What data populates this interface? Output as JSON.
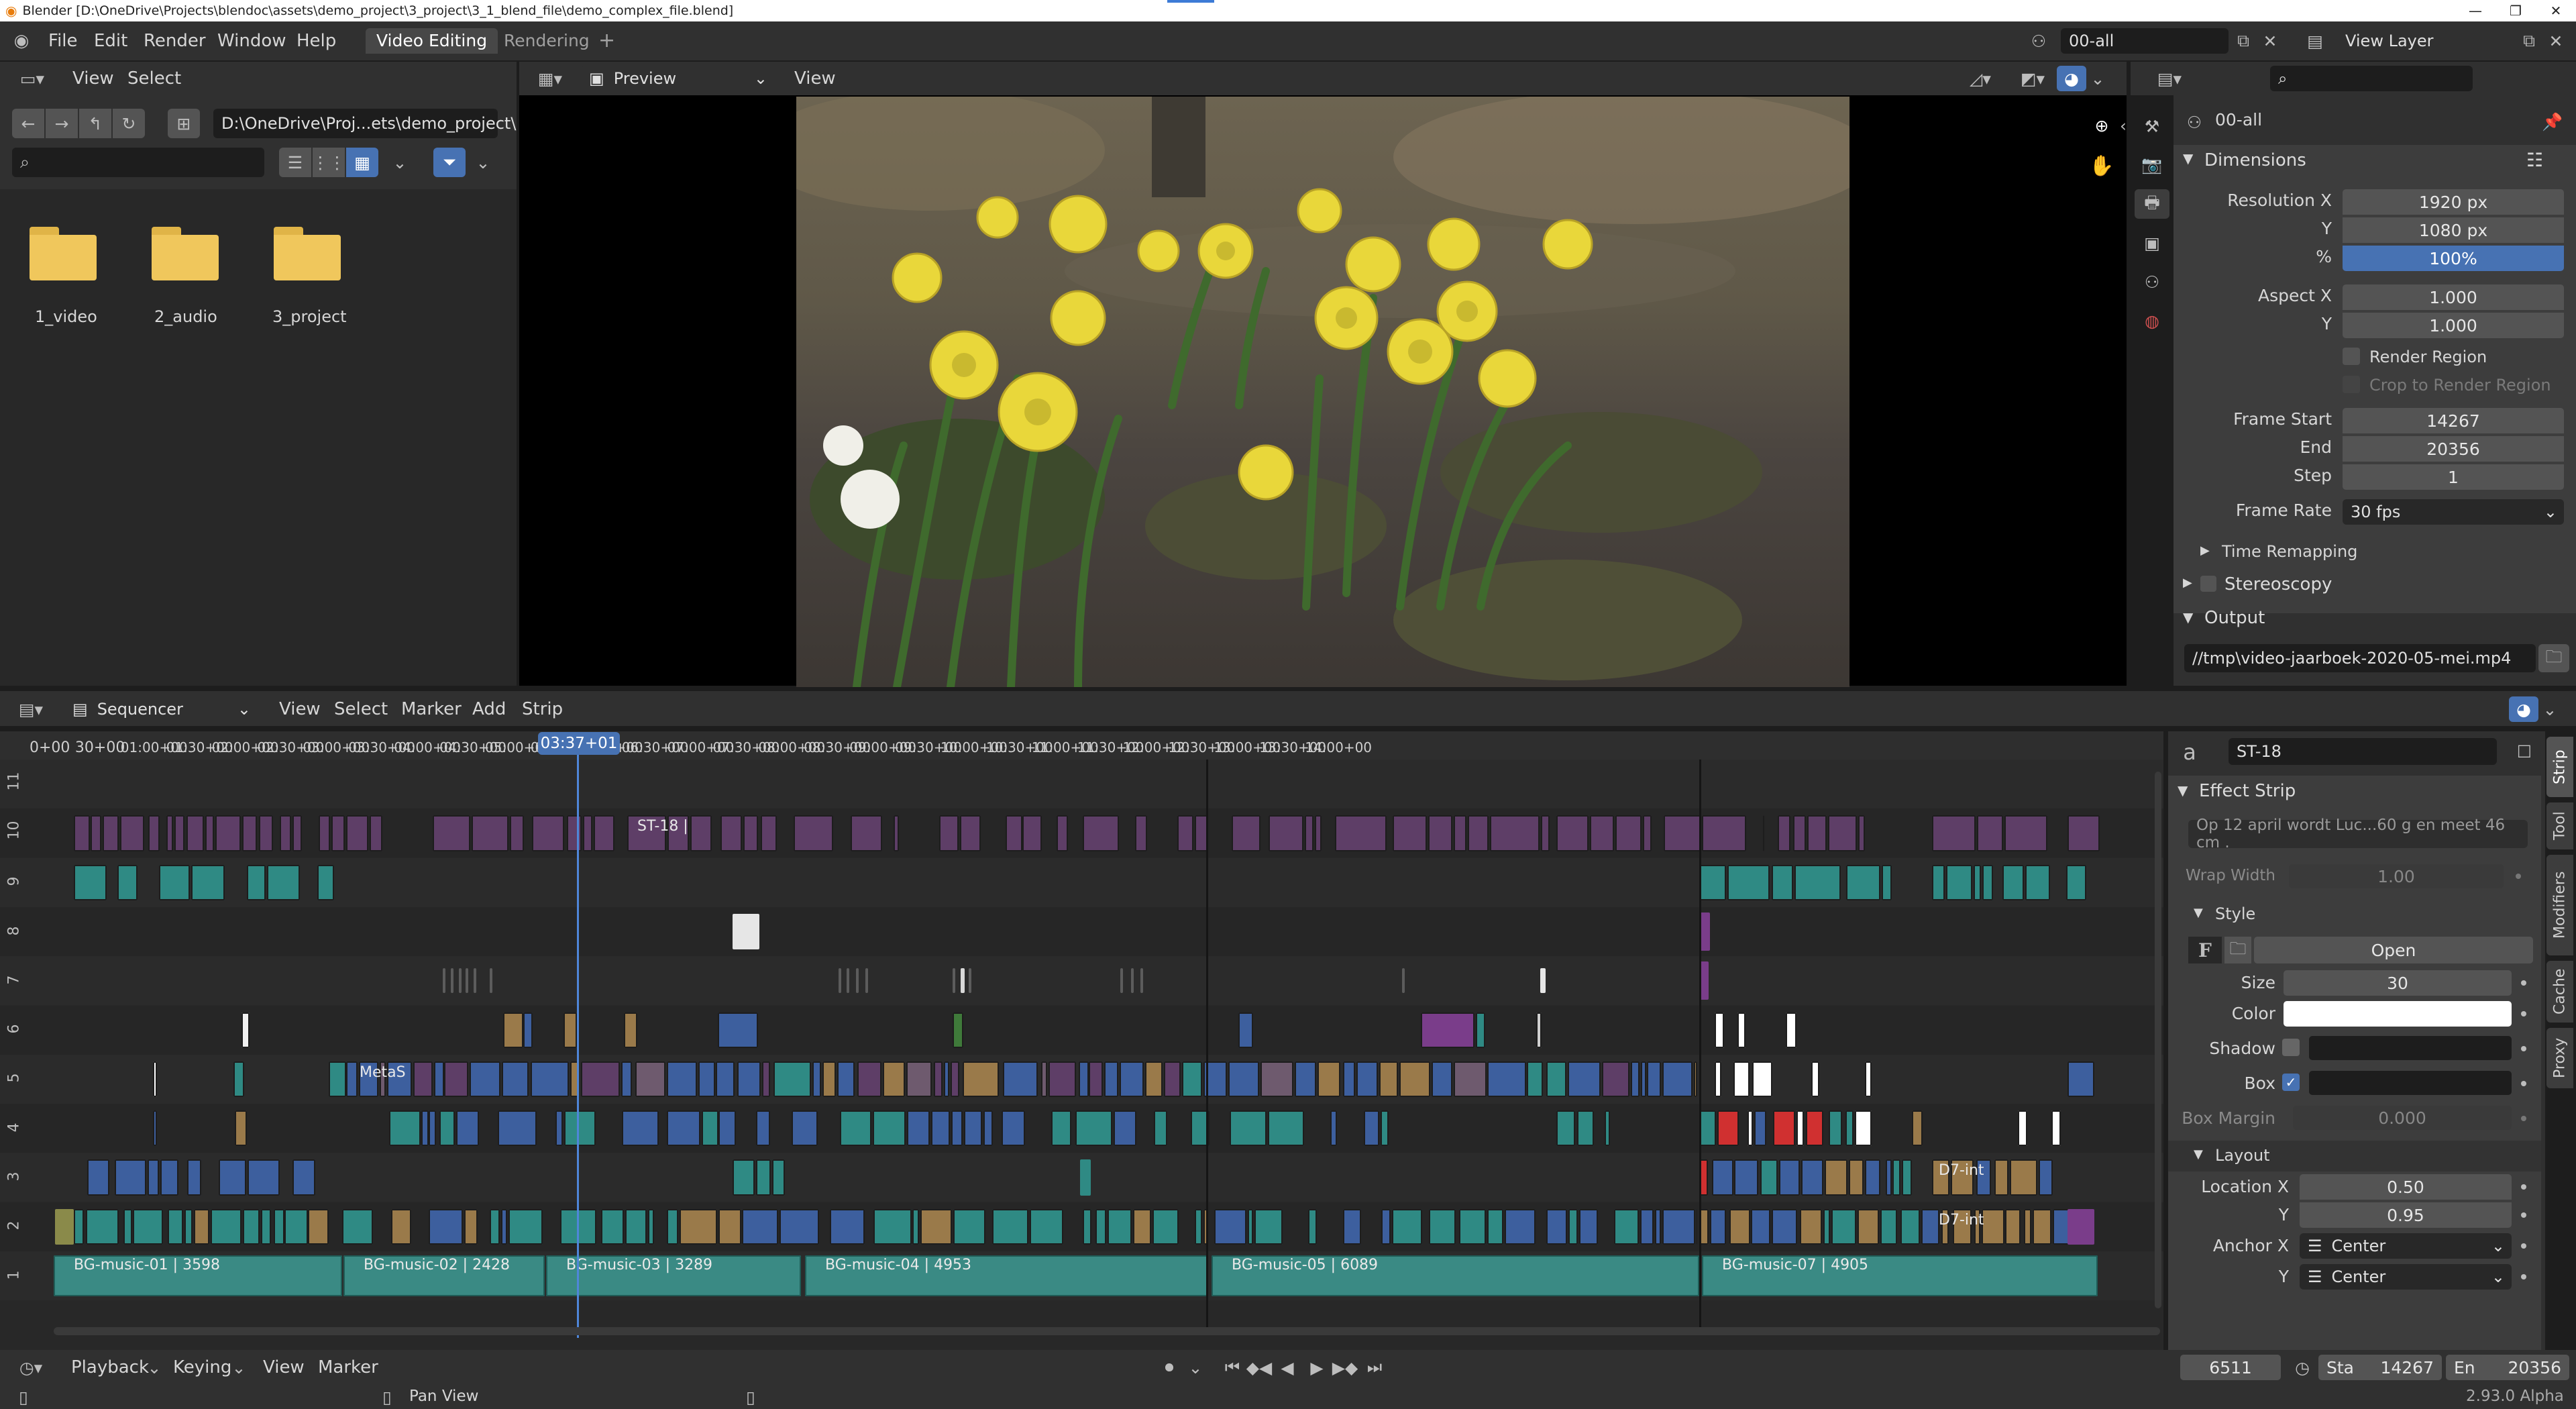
{
  "window": {
    "title": "Blender [D:\\OneDrive\\Projects\\blendoc\\assets\\demo_project\\3_project\\3_1_blend_file\\demo_complex_file.blend]",
    "version": "2.93.0 Alpha"
  },
  "menubar": {
    "items": [
      "File",
      "Edit",
      "Render",
      "Window",
      "Help"
    ],
    "workspaces": [
      "Video Editing",
      "Rendering"
    ],
    "add_tab": "+",
    "scene": "00-all",
    "view_layer": "View Layer"
  },
  "file_browser": {
    "header_menus": [
      "View",
      "Select"
    ],
    "path": "D:\\OneDrive\\Proj...ets\\demo_project\\",
    "search_placeholder": "",
    "folders": [
      "1_video",
      "2_audio",
      "3_project"
    ]
  },
  "preview": {
    "mode": "Preview",
    "view_menu": "View"
  },
  "properties": {
    "scene_name": "00-all",
    "dimensions": {
      "title": "Dimensions",
      "resolution_x_label": "Resolution X",
      "resolution_x": "1920 px",
      "y_label": "Y",
      "resolution_y": "1080 px",
      "percent_label": "%",
      "percent": "100%",
      "aspect_x_label": "Aspect X",
      "aspect_x": "1.000",
      "aspect_y": "1.000",
      "render_region": "Render Region",
      "crop_region": "Crop to Render Region",
      "frame_start_label": "Frame Start",
      "frame_start": "14267",
      "end_label": "End",
      "frame_end": "20356",
      "step_label": "Step",
      "step": "1",
      "frame_rate_label": "Frame Rate",
      "frame_rate": "30 fps"
    },
    "time_remapping": "Time Remapping",
    "stereoscopy": "Stereoscopy",
    "output": {
      "title": "Output",
      "path": "//tmp\\video-jaarboek-2020-05-mei.mp4"
    }
  },
  "sequencer": {
    "header_mode": "Sequencer",
    "header_menus": [
      "View",
      "Select",
      "Marker",
      "Add",
      "Strip"
    ],
    "current_time": "03:37+01",
    "ticks": [
      "0+00",
      "30+00",
      "01:00+00",
      "01:30+00",
      "02:00+00",
      "02:30+00",
      "03:00+00",
      "03:30+00",
      "04:00+00",
      "04:30+00",
      "05:00+00",
      "05:30+00",
      "06:00+00",
      "06:30+00",
      "07:00+00",
      "07:30+00",
      "08:00+00",
      "08:30+00",
      "09:00+00",
      "09:30+00",
      "10:00+00",
      "10:30+00",
      "11:00+00",
      "11:30+00",
      "12:00+00",
      "12:30+00",
      "13:00+00",
      "13:30+00",
      "14:00+00"
    ],
    "channels": [
      "11",
      "10",
      "9",
      "8",
      "7",
      "6",
      "5",
      "4",
      "3",
      "2",
      "1"
    ],
    "strip_labels": {
      "st18": "ST-18 |",
      "metas": "MetaS",
      "d7_3": "D7-int",
      "d7_2": "D7-int"
    },
    "music": [
      "BG-music-01 | 3598",
      "BG-music-02 | 2428",
      "BG-music-03 | 3289",
      "BG-music-04 | 4953",
      "BG-music-05 | 6089",
      "BG-music-07 | 4905"
    ]
  },
  "strip_sidebar": {
    "name": "ST-18",
    "effect_strip": "Effect Strip",
    "text": "Op 12 april wordt Luc...60 g en meet 46 cm .",
    "wrap_width_label": "Wrap Width",
    "wrap_width": "1.00",
    "style": "Style",
    "font_open": "Open",
    "size_label": "Size",
    "size": "30",
    "color_label": "Color",
    "color": "#ffffff",
    "shadow_label": "Shadow",
    "box_label": "Box",
    "box_margin_label": "Box Margin",
    "box_margin": "0.000",
    "layout": "Layout",
    "location_x_label": "Location X",
    "location_x": "0.50",
    "y_label": "Y",
    "location_y": "0.95",
    "anchor_x_label": "Anchor X",
    "anchor_x": "Center",
    "anchor_y": "Center",
    "tabs": [
      "Strip",
      "Tool",
      "Modifiers",
      "Cache",
      "Proxy"
    ]
  },
  "timeline": {
    "menus": [
      "Playback",
      "Keying",
      "View",
      "Marker"
    ],
    "current_frame": "6511",
    "start_label": "Sta",
    "start": "14267",
    "end_label": "En",
    "end": "20356"
  },
  "statusbar": {
    "hint": "Pan View"
  },
  "colors": {
    "accent": "#4772b3",
    "strip_purple": "#5e3e67",
    "strip_teal": "#2f8a84",
    "strip_blue": "#3d5f9e",
    "strip_tan": "#9a7a4a",
    "music": "#3a8a84"
  }
}
